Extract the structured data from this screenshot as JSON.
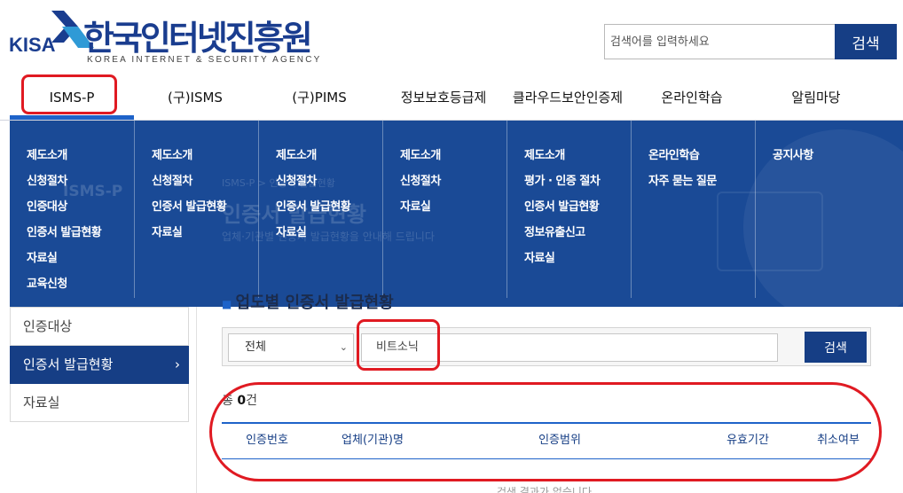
{
  "header": {
    "logo_mark": "KISA",
    "logo_title": "한국인터넷진흥원",
    "logo_subtitle": "KOREA INTERNET & SECURITY AGENCY",
    "search_placeholder": "검색어를 입력하세요",
    "search_button": "검색"
  },
  "gnb": {
    "items": [
      "ISMS-P",
      "(구)ISMS",
      "(구)PIMS",
      "정보보호등급제",
      "클라우드보안인증제",
      "온라인학습",
      "알림마당"
    ],
    "active": "ISMS-P"
  },
  "mega_menu": {
    "columns": [
      [
        "제도소개",
        "신청절차",
        "인증대상",
        "인증서 발급현황",
        "자료실",
        "교육신청"
      ],
      [
        "제도소개",
        "신청절차",
        "인증서 발급현황",
        "자료실"
      ],
      [
        "제도소개",
        "신청절차",
        "인증서 발급현황",
        "자료실"
      ],
      [
        "제도소개",
        "신청절차",
        "자료실"
      ],
      [
        "제도소개",
        "평가 · 인증 절차",
        "인증서 발급현황",
        "정보유출신고",
        "자료실"
      ],
      [
        "온라인학습",
        "자주 묻는 질문"
      ],
      [
        "공지사항"
      ]
    ]
  },
  "background_page": {
    "lnb_title": "ISMS-P",
    "breadcrumb": "ISMS-P > 인증서 발급현황",
    "page_title": "인증서 발급현황",
    "page_desc": "업체·기관별 인증서 발급현황을 안내해 드립니다"
  },
  "lnb": {
    "items": [
      {
        "label": "인증대상",
        "active": false
      },
      {
        "label": "인증서 발급현황",
        "active": true
      },
      {
        "label": "자료실",
        "active": false
      }
    ],
    "active_chevron": "›"
  },
  "section": {
    "title": "업도별 인증서 발급현황"
  },
  "filter": {
    "select_value": "전체",
    "select_caret": "⌄",
    "input_value": "비트소닉",
    "button": "검색"
  },
  "results": {
    "total_prefix": "총",
    "total_count": "0",
    "total_suffix": "건",
    "columns": [
      "인증번호",
      "업체(기관)명",
      "인증범위",
      "유효기간",
      "취소여부"
    ],
    "empty_text": "검색 결과가 없습니다"
  },
  "colors": {
    "brand_blue": "#163e85",
    "menu_blue": "#1a4a96",
    "accent_blue": "#1e63c9",
    "annotation_red": "#e01a22"
  }
}
